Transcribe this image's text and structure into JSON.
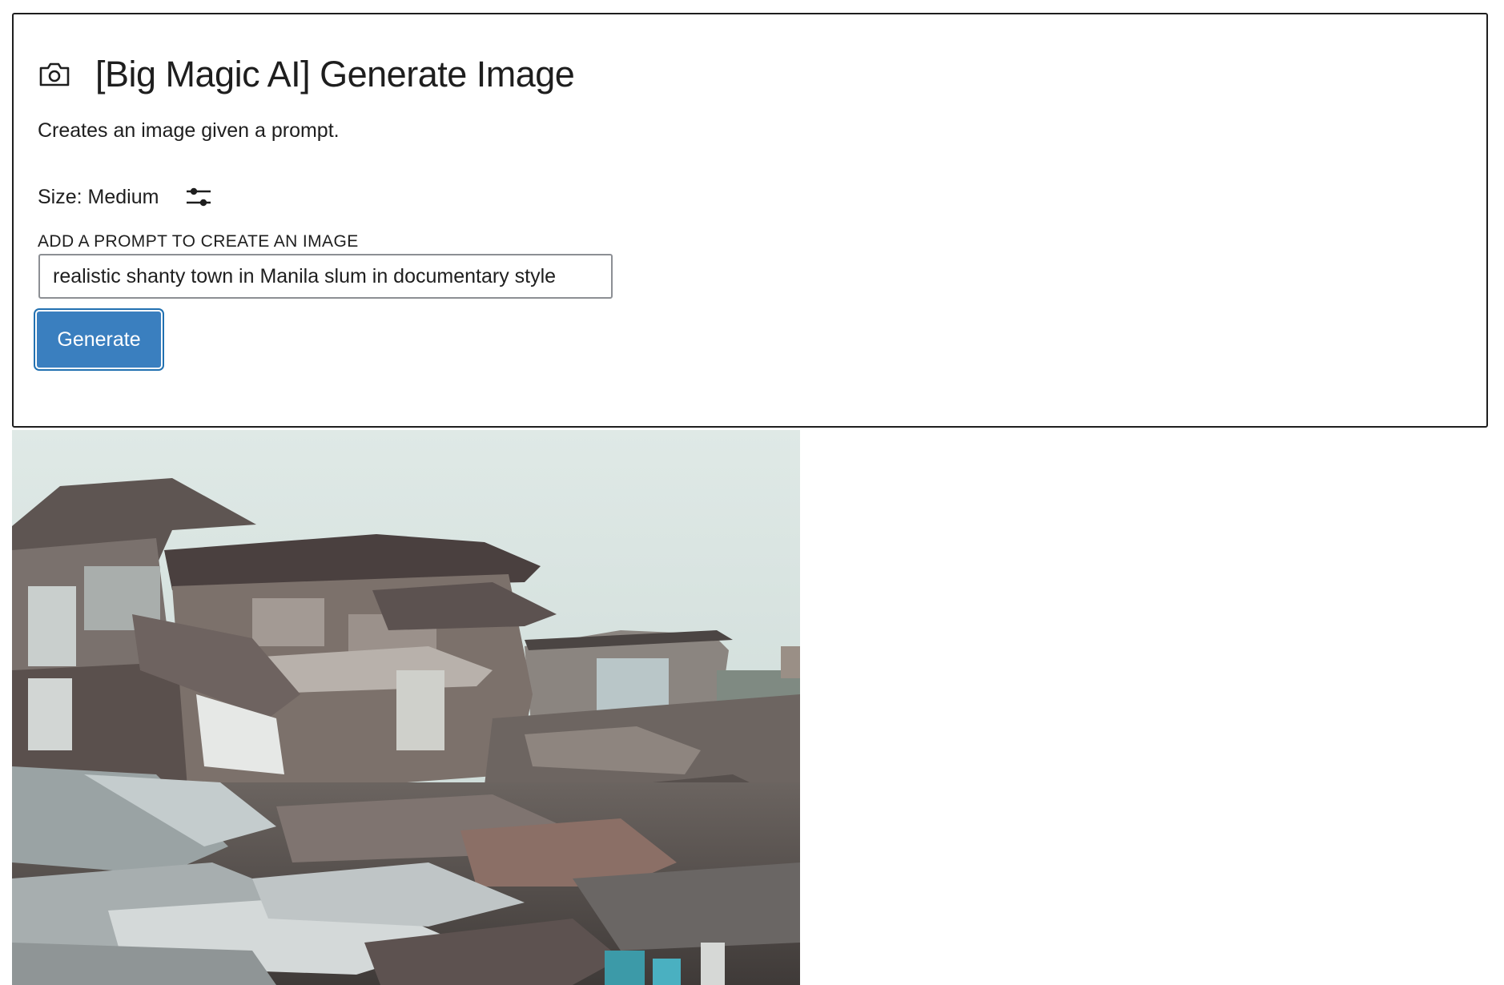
{
  "block": {
    "icon": "camera-icon",
    "title": "[Big Magic AI] Generate Image",
    "description": "Creates an image given a prompt."
  },
  "size": {
    "label": "Size: Medium",
    "settings_icon": "sliders-icon"
  },
  "prompt": {
    "label": "ADD A PROMPT TO CREATE AN IMAGE",
    "value": "realistic shanty town in Manila slum in documentary style"
  },
  "actions": {
    "generate_label": "Generate"
  },
  "colors": {
    "accent": "#3a7fbf",
    "focus_ring": "#2271b1",
    "text": "#1e1e1e",
    "border": "#1e1e1e"
  }
}
